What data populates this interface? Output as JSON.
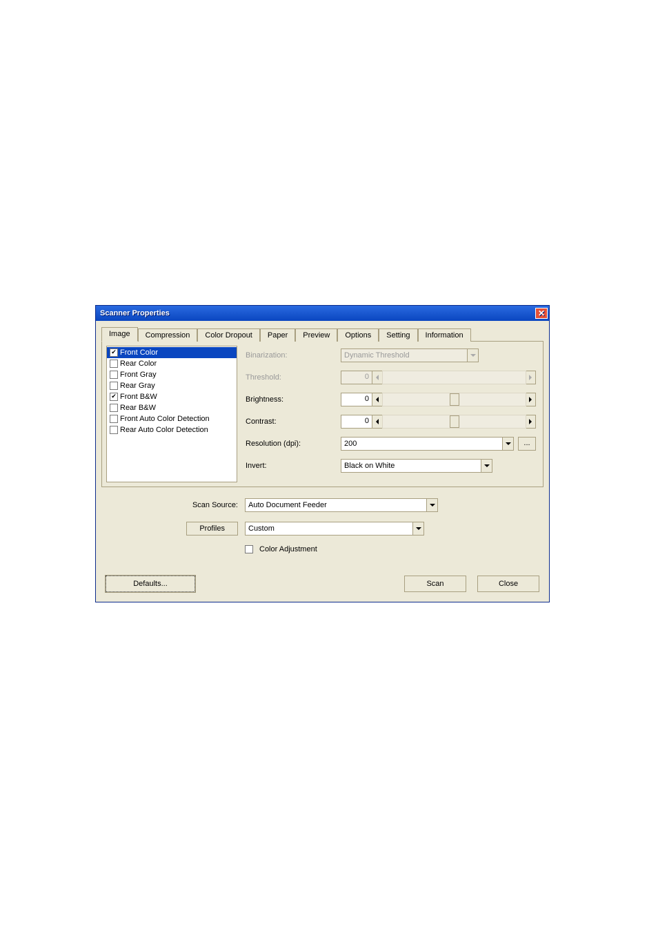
{
  "window": {
    "title": "Scanner Properties"
  },
  "tabs": [
    "Image",
    "Compression",
    "Color Dropout",
    "Paper",
    "Preview",
    "Options",
    "Setting",
    "Information"
  ],
  "active_tab": 0,
  "side_items": [
    {
      "label": "Front Color",
      "checked": true,
      "selected": true
    },
    {
      "label": "Rear Color",
      "checked": false,
      "selected": false
    },
    {
      "label": "Front Gray",
      "checked": false,
      "selected": false
    },
    {
      "label": "Rear Gray",
      "checked": false,
      "selected": false
    },
    {
      "label": "Front B&W",
      "checked": true,
      "selected": false
    },
    {
      "label": "Rear B&W",
      "checked": false,
      "selected": false
    },
    {
      "label": "Front Auto Color Detection",
      "checked": false,
      "selected": false
    },
    {
      "label": "Rear Auto Color Detection",
      "checked": false,
      "selected": false
    }
  ],
  "image_panel": {
    "binarization": {
      "label": "Binarization:",
      "value": "Dynamic Threshold",
      "enabled": false
    },
    "threshold": {
      "label": "Threshold:",
      "value": "0",
      "enabled": false
    },
    "brightness": {
      "label": "Brightness:",
      "value": "0",
      "enabled": true
    },
    "contrast": {
      "label": "Contrast:",
      "value": "0",
      "enabled": true
    },
    "resolution": {
      "label": "Resolution (dpi):",
      "value": "200"
    },
    "invert": {
      "label": "Invert:",
      "value": "Black on White"
    }
  },
  "lower": {
    "scan_source": {
      "label": "Scan Source:",
      "value": "Auto Document Feeder"
    },
    "profiles": {
      "label": "Profiles",
      "value": "Custom"
    },
    "color_adjustment": {
      "label": "Color Adjustment",
      "checked": false
    }
  },
  "buttons": {
    "defaults": "Defaults...",
    "scan": "Scan",
    "close": "Close",
    "more": "..."
  }
}
